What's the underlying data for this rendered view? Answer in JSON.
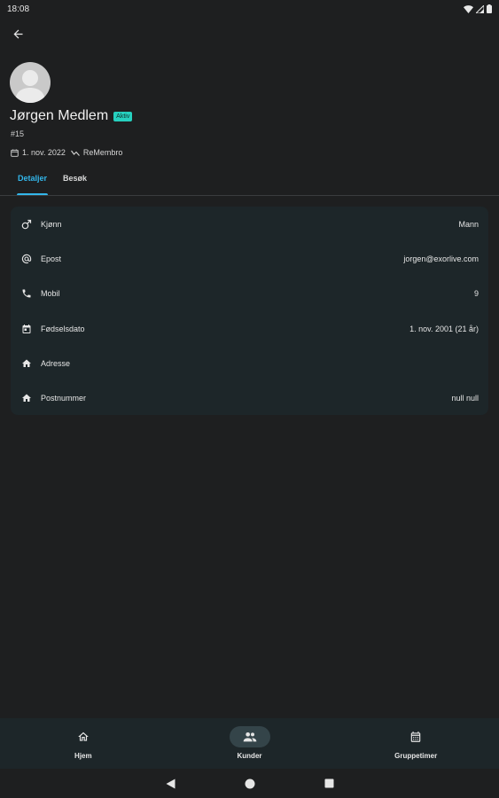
{
  "status_bar": {
    "time": "18:08"
  },
  "profile": {
    "name": "Jørgen Medlem",
    "status": "Aktiv",
    "number": "#15",
    "date": "1. nov. 2022",
    "source": "ReMembro"
  },
  "tabs": [
    {
      "label": "Detaljer",
      "active": true
    },
    {
      "label": "Besøk",
      "active": false
    }
  ],
  "details": [
    {
      "icon": "male-icon",
      "label": "Kjønn",
      "value": "Mann"
    },
    {
      "icon": "at-icon",
      "label": "Epost",
      "value": "jorgen@exorlive.com"
    },
    {
      "icon": "phone-icon",
      "label": "Mobil",
      "value": "9"
    },
    {
      "icon": "calendar-icon",
      "label": "Fødselsdato",
      "value": "1. nov. 2001 (21 år)"
    },
    {
      "icon": "home-icon",
      "label": "Adresse",
      "value": ""
    },
    {
      "icon": "home-icon",
      "label": "Postnummer",
      "value": "null null"
    }
  ],
  "bottom_nav": [
    {
      "icon": "home-icon",
      "label": "Hjem",
      "active": false
    },
    {
      "icon": "people-icon",
      "label": "Kunder",
      "active": true
    },
    {
      "icon": "calendar-grid-icon",
      "label": "Gruppetimer",
      "active": false
    }
  ],
  "colors": {
    "background": "#1e1f20",
    "card": "#1d2629",
    "accent": "#33b6ea",
    "badge": "#26d0bf"
  }
}
